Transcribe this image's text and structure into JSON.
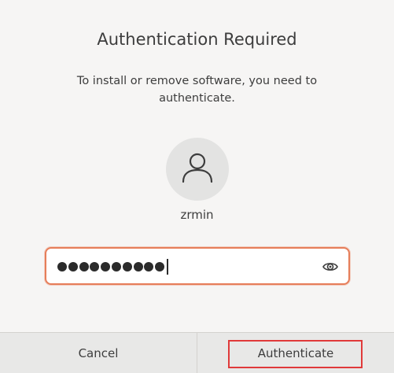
{
  "dialog": {
    "title": "Authentication Required",
    "message": "To install or remove software, you need to authenticate.",
    "username": "zrmin",
    "password": {
      "masked_length": 10,
      "show_password_icon": "eye-icon"
    },
    "avatar_icon": "user-icon",
    "buttons": {
      "cancel_label": "Cancel",
      "authenticate_label": "Authenticate"
    }
  },
  "colors": {
    "background": "#f6f5f4",
    "focus_border": "#e67e5a",
    "highlight_box": "#e03a3a"
  }
}
